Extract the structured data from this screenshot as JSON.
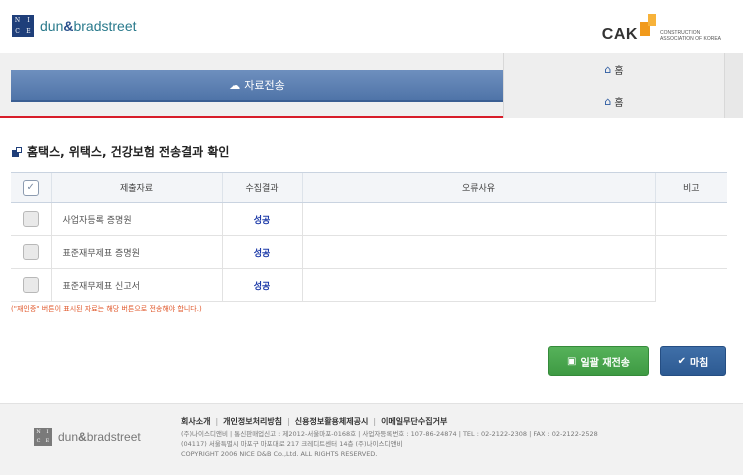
{
  "header": {
    "nice_logo_text": "NICE",
    "brand_left": "dun",
    "brand_amp": "&",
    "brand_right": "bradstreet",
    "cak_word": "CAK",
    "cak_sub_1": "CONSTRUCTION",
    "cak_sub_2": "ASSOCIATION OF KOREA"
  },
  "nav": {
    "transfer_tab": "자료전송",
    "home_1": "홈",
    "home_2": "홈"
  },
  "section": {
    "title": "홈택스, 위택스, 건강보험 전송결과 확인"
  },
  "table": {
    "headers": [
      "제출자료",
      "수집결과",
      "오류사유",
      "비고"
    ],
    "rows": [
      {
        "doc": "사업자등록 증명원",
        "result": "성공"
      },
      {
        "doc": "표준재무제표 증명원",
        "result": "성공"
      },
      {
        "doc": "표준재무제표 신고서",
        "result": "성공"
      }
    ]
  },
  "note": "(\"재인증\" 버튼이 표시된 자료는 해당 버튼으로 전송해야 합니다.)",
  "buttons": {
    "resend": "일괄 재전송",
    "finish": "마침"
  },
  "footer": {
    "links": [
      "회사소개",
      "개인정보처리방침",
      "신용정보활용체제공시",
      "이메일무단수집거부"
    ],
    "line1": "(주)나이스디앤비  |  통신판매업신고 : 제2012-서울마포-0168호  |  사업자등록번호 : 107-86-24874  |  TEL : 02-2122-2308  |  FAX : 02-2122-2528",
    "line2": "(04117) 서울특별시 마포구 마포대로 217 크레디트센터 14층 (주)나이스디앤비",
    "line3": "COPYRIGHT 2006 NICE D&B Co.,Ltd. ALL RIGHTS RESERVED."
  },
  "colors": {
    "accent_red": "#d81d2a",
    "tab_blue": "#4f74a8",
    "success_text": "#1c3aa8",
    "resend_green": "#3e9a43",
    "finish_blue": "#2d5a92"
  }
}
